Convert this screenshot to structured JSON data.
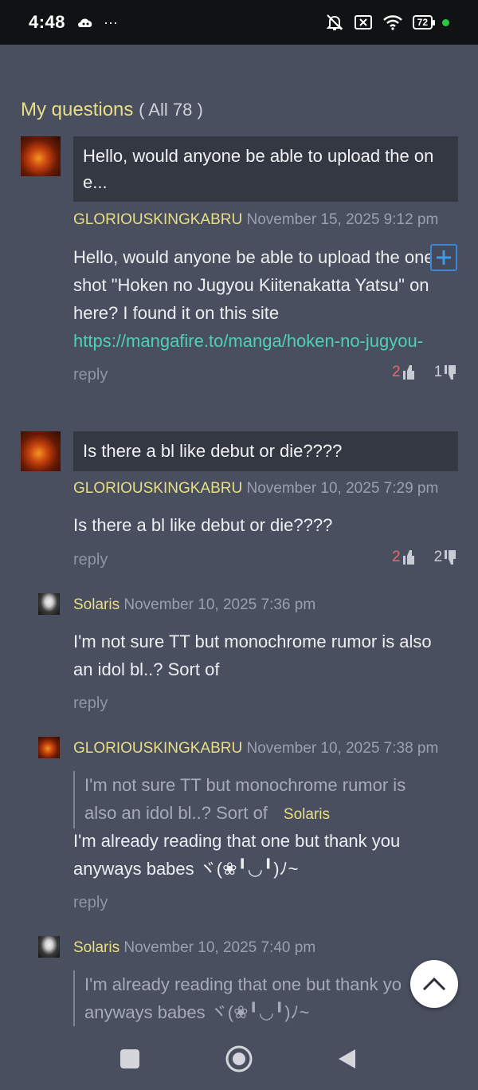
{
  "status": {
    "time": "4:48",
    "left_icons": [
      "cloud-game-icon",
      "more-dots-icon"
    ],
    "more": "···",
    "right_icons": [
      "bell-off-icon",
      "no-sim-icon",
      "wifi-icon",
      "battery-icon"
    ],
    "battery": "72"
  },
  "page": {
    "title": "My questions",
    "count": "( All 78 )"
  },
  "threads": [
    {
      "summary": "Hello, would anyone be able to upload the on e...",
      "summary_line1": "Hello, would anyone be able to upload the on",
      "summary_line2": "e...",
      "user": "GLORIOUSKINGKABRU",
      "date": "November 15, 2025 9:12 pm",
      "body_lines": [
        "Hello, would anyone be able to upload the one",
        "shot \"Hoken no Jugyou Kiitenakatta Yatsu\" on",
        "here? I found it on this site"
      ],
      "link": "https://mangafire.to/manga/hoken-no-jugyou-",
      "reply": "reply",
      "upvotes": "2",
      "downvotes": "1"
    },
    {
      "summary": "Is there a bl like debut or die????",
      "user": "GLORIOUSKINGKABRU",
      "date": "November 10, 2025 7:29 pm",
      "body": "Is there a bl like debut or die????",
      "reply": "reply",
      "upvotes": "2",
      "downvotes": "2",
      "replies": [
        {
          "user": "Solaris",
          "date": "November 10, 2025 7:36 pm",
          "body_lines": [
            "I'm not sure TT but monochrome rumor is also",
            "an idol bl..? Sort of"
          ],
          "reply": "reply"
        },
        {
          "user": "GLORIOUSKINGKABRU",
          "date": "November 10, 2025 7:38 pm",
          "quote_lines": [
            "I'm not sure TT but monochrome rumor is",
            "also an idol bl..? Sort of"
          ],
          "quote_user": "Solaris",
          "body_lines": [
            "I'm already reading that one but thank you",
            "anyways babes ヾ(❀╹◡╹)ﾉ~"
          ],
          "reply": "reply"
        },
        {
          "user": "Solaris",
          "date": "November 10, 2025 7:40 pm",
          "quote_lines": [
            "I'm already reading that one but thank yo",
            "anyways babes ヾ(❀╹◡╹)ﾉ~"
          ]
        }
      ]
    }
  ],
  "colors": {
    "background": "#4a4f5f",
    "username": "#e8de86",
    "link": "#4fd1b1",
    "upvote": "#e46b6b"
  }
}
